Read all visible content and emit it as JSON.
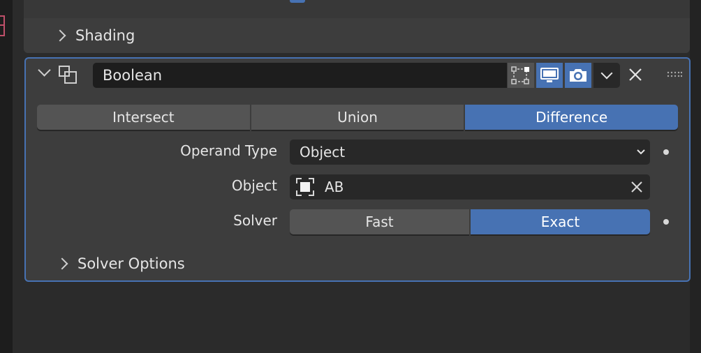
{
  "colors": {
    "accent": "#4772b3",
    "panel": "#3d3d3d",
    "background": "#2b2b2b",
    "field": "#282828",
    "button": "#545454"
  },
  "previous_panel": {
    "subpanel_label": "Shading"
  },
  "modifier": {
    "name": "Boolean",
    "icon": "boolean-modifier-icon",
    "header_toggles": [
      {
        "name": "edit-mode",
        "icon": "edit-mode-icon",
        "active": false
      },
      {
        "name": "viewport",
        "icon": "monitor-icon",
        "active": true
      },
      {
        "name": "render",
        "icon": "camera-icon",
        "active": true
      }
    ],
    "operations": [
      "Intersect",
      "Union",
      "Difference"
    ],
    "active_operation": "Difference",
    "operand_type": {
      "label": "Operand Type",
      "value": "Object"
    },
    "object": {
      "label": "Object",
      "value": "AB",
      "icon": "object-icon"
    },
    "solver": {
      "label": "Solver",
      "options": [
        "Fast",
        "Exact"
      ],
      "active": "Exact"
    },
    "solver_options_label": "Solver Options"
  }
}
